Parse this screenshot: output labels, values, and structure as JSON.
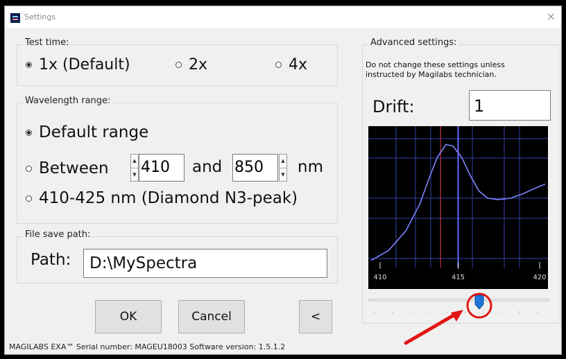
{
  "window": {
    "title": "Settings",
    "close_label": "×"
  },
  "test_time": {
    "legend": "Test time:",
    "options": [
      {
        "label": "1x (Default)",
        "selected": true
      },
      {
        "label": "2x",
        "selected": false
      },
      {
        "label": "4x",
        "selected": false
      }
    ]
  },
  "wavelength": {
    "legend": "Wavelength range:",
    "default_label": "Default range",
    "between_label": "Between",
    "and_label": "and",
    "unit_label": "nm",
    "from_value": "410",
    "to_value": "850",
    "diamond_label": "410-425 nm (Diamond N3-peak)",
    "selected": "Default range"
  },
  "file_save": {
    "legend": "File save path:",
    "path_label": "Path:",
    "path_value": "D:\\MySpectra"
  },
  "buttons": {
    "ok": "OK",
    "cancel": "Cancel",
    "back": "<"
  },
  "footer": "MAGILABS EXA™    Serial number: MAGEU18003    Software version: 1.5.1.2",
  "advanced": {
    "legend": "Advanced settings:",
    "note": "Do not change these settings unless instructed by Magilabs technician.",
    "drift_label": "Drift:",
    "drift_value": "1"
  },
  "chart_data": {
    "type": "line",
    "x_ticks": [
      "410",
      "415",
      "420"
    ],
    "xlim": [
      410,
      420
    ],
    "series": [
      {
        "x": [
          410,
          411,
          412,
          412.8,
          413.3,
          413.8,
          414.3,
          414.7,
          415.2,
          415.7,
          416.2,
          416.7,
          417.3,
          418,
          418.7,
          419.4,
          420
        ],
        "y": [
          0.05,
          0.12,
          0.26,
          0.45,
          0.62,
          0.78,
          0.87,
          0.86,
          0.78,
          0.65,
          0.54,
          0.49,
          0.48,
          0.49,
          0.52,
          0.56,
          0.59
        ],
        "color": "#7b86ff"
      }
    ],
    "red_marker_x": 414,
    "blue_marker_x": 415,
    "grid": true
  },
  "slider": {
    "value_fraction": 0.59,
    "marker": "red circle and arrow highlight"
  }
}
